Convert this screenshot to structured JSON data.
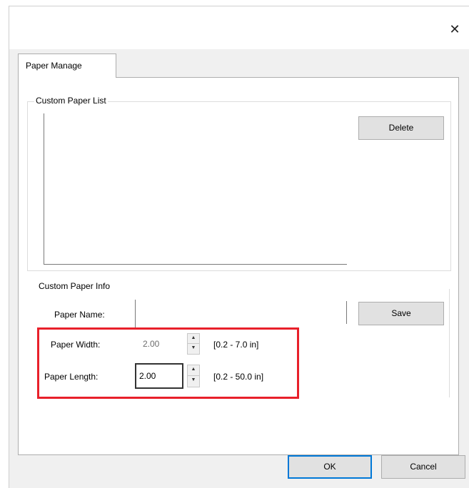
{
  "window": {
    "close_glyph": "✕"
  },
  "tabs": [
    {
      "label": "Paper Manage"
    }
  ],
  "custom_paper_list": {
    "title": "Custom Paper List",
    "delete_label": "Delete"
  },
  "custom_paper_info": {
    "title": "Custom Paper Info",
    "paper_name_label": "Paper Name:",
    "paper_name_value": "",
    "save_label": "Save",
    "paper_width_label": "Paper Width:",
    "paper_width_value": "2.00",
    "paper_width_range": "[0.2 - 7.0 in]",
    "paper_length_label": "Paper Length:",
    "paper_length_value": "2.00",
    "paper_length_range": "[0.2 - 50.0 in]"
  },
  "footer": {
    "ok_label": "OK",
    "cancel_label": "Cancel"
  },
  "colors": {
    "highlight": "#e8202a",
    "default_button_border": "#0078d7"
  }
}
